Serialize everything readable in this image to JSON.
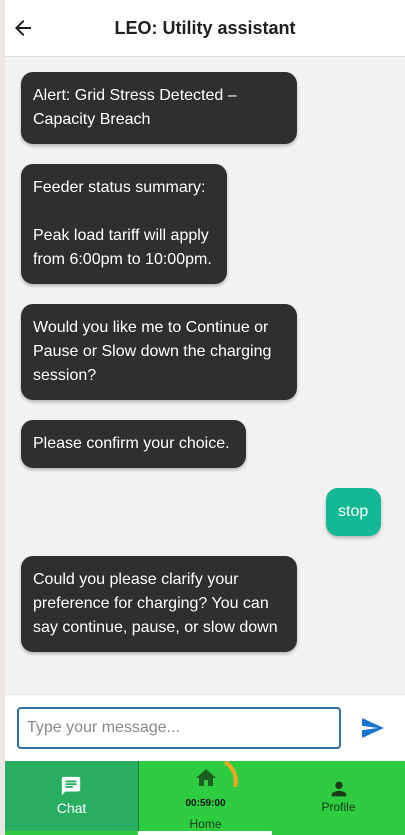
{
  "header": {
    "title": "LEO: Utility assistant",
    "back_icon": "arrow-left-icon"
  },
  "messages": [
    {
      "sender": "bot",
      "text": "Alert: Grid Stress Detected –\nCapacity Breach"
    },
    {
      "sender": "bot",
      "text": "Feeder status summary:\n\nPeak load tariff will apply\nfrom 6:00pm to 10:00pm."
    },
    {
      "sender": "bot",
      "text": "Would you like me to Continue or\nPause or Slow down the charging\nsession?"
    },
    {
      "sender": "bot",
      "text": "Please confirm your choice."
    },
    {
      "sender": "user",
      "text": "stop"
    },
    {
      "sender": "bot",
      "text": "Could you please clarify your\npreference for charging? You can\nsay continue, pause, or slow down"
    }
  ],
  "composer": {
    "placeholder": "Type your message...",
    "value": "",
    "send_icon": "send-icon"
  },
  "nav": {
    "chat_label": "Chat",
    "home_label": "Home",
    "profile_label": "Profile",
    "timer": "00:59:00",
    "timer_progress": 0.25,
    "active": "chat"
  },
  "colors": {
    "bot_bubble": "#2f2f2f",
    "user_bubble": "#14b894",
    "nav_bg": "#2ecc40",
    "nav_active": "#27ae60",
    "timer_arc": "#f5a623",
    "accent": "#2e6fa6"
  }
}
